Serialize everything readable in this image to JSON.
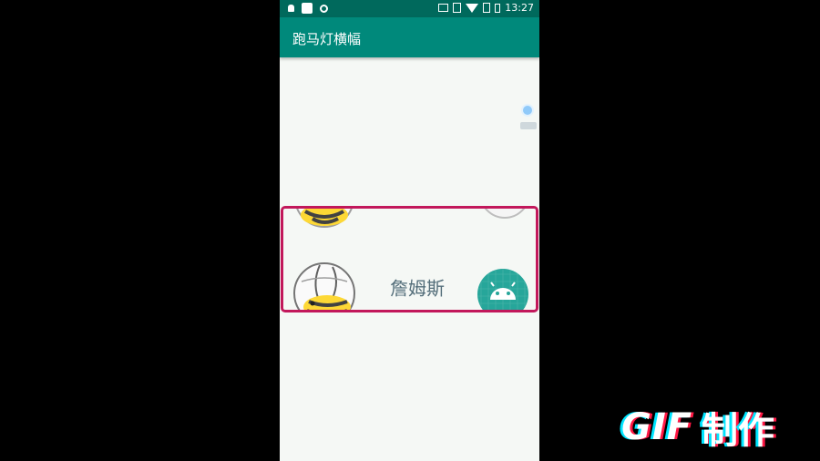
{
  "status_bar": {
    "time": "13:27",
    "icons_left": [
      "notification-icon",
      "square-app-icon",
      "record-icon"
    ],
    "icons_right": [
      "cast-icon",
      "vibrate-icon",
      "wifi-icon",
      "no-sim-icon",
      "battery-icon"
    ]
  },
  "toolbar": {
    "title": "跑马灯横幅",
    "color": "#00897b"
  },
  "banner": {
    "border_color": "#c2185b",
    "current_text": "詹姆斯",
    "items": [
      "bee-avatar",
      "android-avatar"
    ]
  },
  "watermark": {
    "letters": "GIF",
    "chinese": "制作"
  }
}
